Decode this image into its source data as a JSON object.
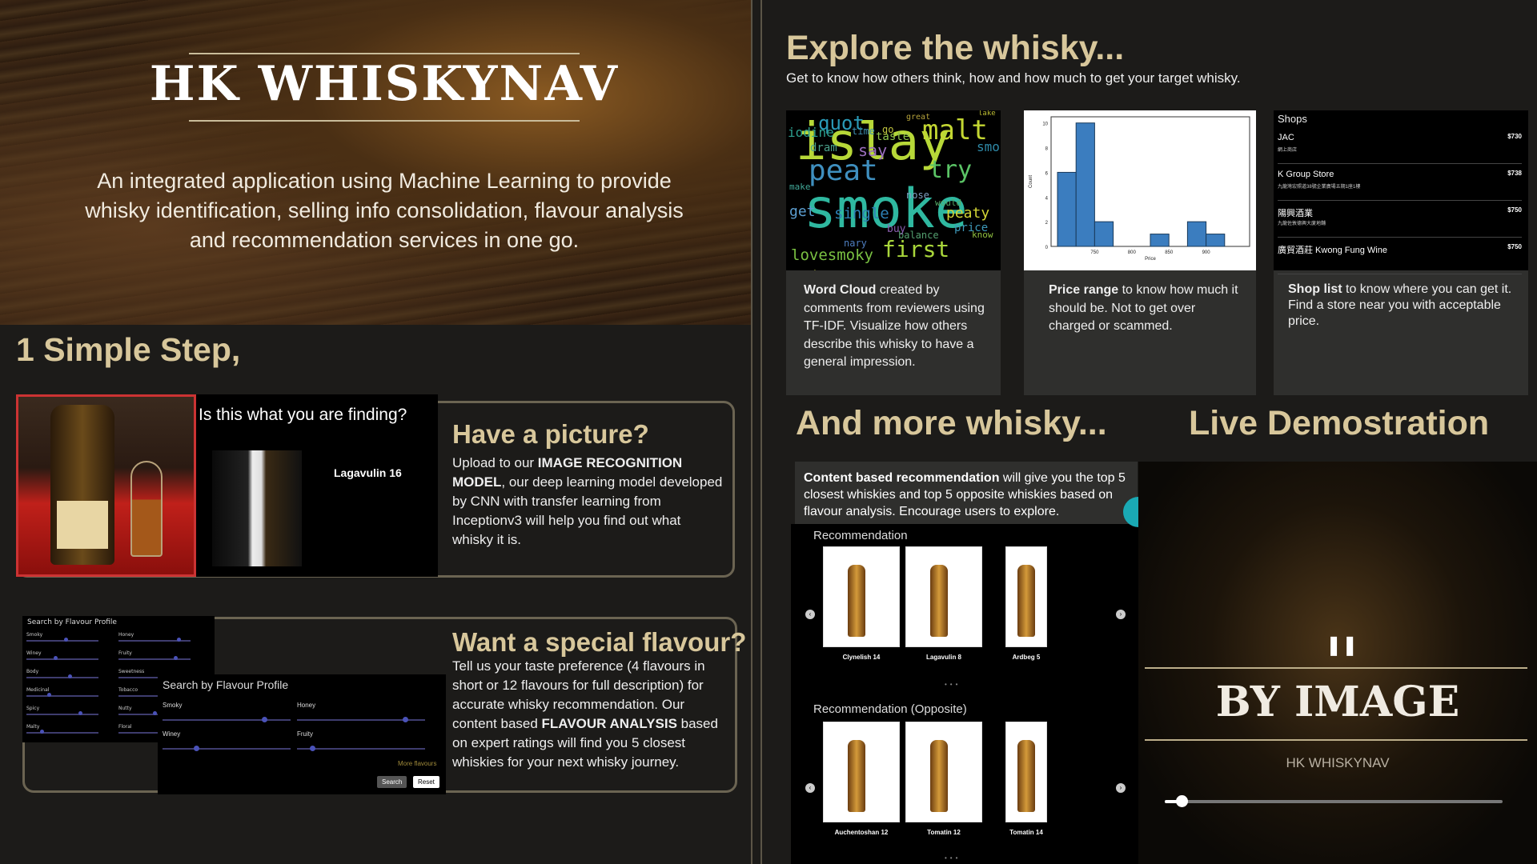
{
  "hero": {
    "title": "HK WHISKYNAV",
    "description": "An integrated application using Machine Learning to provide whisky identification, selling info consolidation, flavour analysis and recommendation services in one go."
  },
  "left": {
    "step_heading": "1 Simple Step,",
    "image_card": {
      "title": "Have a picture?",
      "text_pre": "Upload to our ",
      "text_bold": "IMAGE RECOGNITION MODEL",
      "text_post": ", our deep learning model developed by CNN with transfer learning from Inceptionv3 will help you find out what whisky it is.",
      "mock_question": "Is this what you are finding?",
      "mock_result": "Lagavulin 16"
    },
    "flavour_card": {
      "title": "Want a special flavour?",
      "text_pre": "Tell us your taste preference (4 flavours in short or 12 flavours for full description) for accurate whisky recommendation. Our content based ",
      "text_bold": "FLAVOUR ANALYSIS",
      "text_post": " based on expert ratings will find you 5 closest whiskies for your next whisky journey.",
      "mock_small_title": "Search by Flavour Profile",
      "mock_small_flavours": [
        "Smoky",
        "Honey",
        "Winey",
        "Fruity",
        "Body",
        "Sweetness",
        "Medicinal",
        "Tobacco",
        "Spicy",
        "Nutty",
        "Malty",
        "Floral"
      ],
      "mock_big_title": "Search by Flavour Profile",
      "mock_big_flavours": [
        "Smoky",
        "Honey",
        "Winey",
        "Fruity"
      ],
      "more_link": "More flavours",
      "search_btn": "Search",
      "reset_btn": "Reset"
    }
  },
  "right": {
    "explore_heading": "Explore the whisky...",
    "explore_sub": "Get to know how others think, how and how much to get your target whisky.",
    "wordcloud_card": {
      "bold": "Word Cloud",
      "text": " created by comments from reviewers using TF-IDF. Visualize how others describe this whisky to have a general impression.",
      "words": [
        "islay",
        "smoke",
        "peat",
        "malt",
        "quot",
        "try",
        "lovesmoky",
        "first",
        "single",
        "iodine",
        "peaty",
        "nose",
        "sweet",
        "great",
        "say",
        "dram",
        "smooth",
        "balance",
        "nary",
        "buy",
        "price",
        "would",
        "know",
        "lake",
        "make",
        "get",
        "taste",
        "go",
        "time"
      ]
    },
    "price_card": {
      "bold": "Price range",
      "text": " to know how much it should be. Not to get over charged or scammed."
    },
    "shop_card": {
      "bold": "Shop list",
      "text": " to know where you can get it. Find a store near you with acceptable price.",
      "mock_title": "Shops",
      "shops": [
        {
          "name": "JAC",
          "sub": "網上商店",
          "price": "$730"
        },
        {
          "name": "K Group Store",
          "sub": "九龍灣宏照道38號企業廣場五期1座1樓",
          "price": "$738"
        },
        {
          "name": "陽興酒業",
          "sub": "九龍佐敦德興大廈地舖",
          "price": "$750"
        },
        {
          "name": "廣貿酒莊 Kwong Fung Wine",
          "sub": "",
          "price": "$750"
        }
      ]
    },
    "more_heading": "And more whisky...",
    "live_heading": "Live Demostration",
    "rec_note": {
      "bold": "Content based recommendation",
      "text": " will give you the top 5 closest whiskies and top 5 opposite whiskies based on flavour analysis. Encourage users to explore."
    },
    "rec_mock": {
      "rec_title": "Recommendation",
      "rec_items": [
        "Clynelish 14",
        "Lagavulin 8",
        "Ardbeg 5"
      ],
      "opp_title": "Recommendation (Opposite)",
      "opp_items": [
        "Auchentoshan 12",
        "Tomatin 12",
        "Tomatin 14"
      ]
    },
    "video": {
      "title": "BY IMAGE",
      "subtitle": "HK WHISKYNAV",
      "progress": 0.05,
      "state_icon": "pause-icon"
    }
  },
  "chart_data": {
    "type": "bar",
    "categories": [
      "700-725",
      "725-750",
      "750-775",
      "775-800",
      "800-825",
      "825-850",
      "850-875",
      "875-900",
      "900-925",
      "925-950"
    ],
    "values": [
      6,
      10,
      2,
      0,
      0,
      1,
      0,
      2,
      1,
      0
    ],
    "xlabel": "Price",
    "ylabel": "Count",
    "xticks": [
      "750",
      "800",
      "850",
      "900"
    ],
    "yticks": [
      "0",
      "2",
      "4",
      "6",
      "8",
      "10"
    ],
    "ylim": [
      0,
      10.5
    ],
    "color": "#3b7dbf"
  }
}
